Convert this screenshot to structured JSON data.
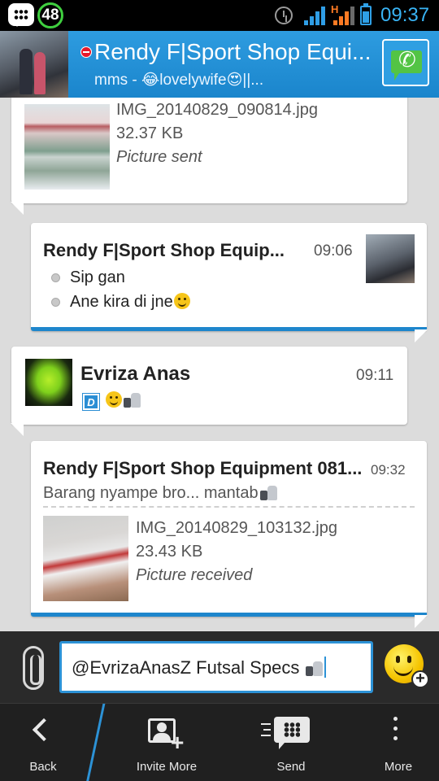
{
  "status_bar": {
    "notification_count": "48",
    "network_type": "H",
    "time": "09:37"
  },
  "header": {
    "contact_name": "Rendy F|Sport Shop Equi...",
    "status_message": "mms - 😂lovelywife😍||...",
    "call_icon": "bbm-voice-call-icon"
  },
  "messages": [
    {
      "type": "file",
      "file_name": "IMG_20140829_090814.jpg",
      "file_size": "32.37 KB",
      "file_status": "Picture sent"
    },
    {
      "type": "incoming",
      "sender": "Rendy F|Sport Shop Equip...",
      "time": "09:06",
      "lines": [
        "Sip gan",
        "Ane kira di jne"
      ]
    },
    {
      "type": "outgoing",
      "sender": "Evriza Anas",
      "time": "09:11",
      "badge": "D"
    },
    {
      "type": "incoming-file",
      "sender": "Rendy F|Sport Shop Equipment 081...",
      "time": "09:32",
      "text": "Barang nyampe bro... mantab",
      "file_name": "IMG_20140829_103132.jpg",
      "file_size": "23.43 KB",
      "file_status": "Picture received"
    }
  ],
  "composer": {
    "value": "@EvrizaAnasZ Futsal Specs "
  },
  "actions": [
    {
      "label": "Back",
      "icon": "back-chevron-icon"
    },
    {
      "label": "Invite More",
      "icon": "invite-contact-icon"
    },
    {
      "label": "Send",
      "icon": "bbm-send-icon"
    },
    {
      "label": "More",
      "icon": "overflow-menu-icon"
    }
  ],
  "colors": {
    "accent": "#1e86cc",
    "header": "#2e9ce0",
    "time": "#39b4f5"
  }
}
